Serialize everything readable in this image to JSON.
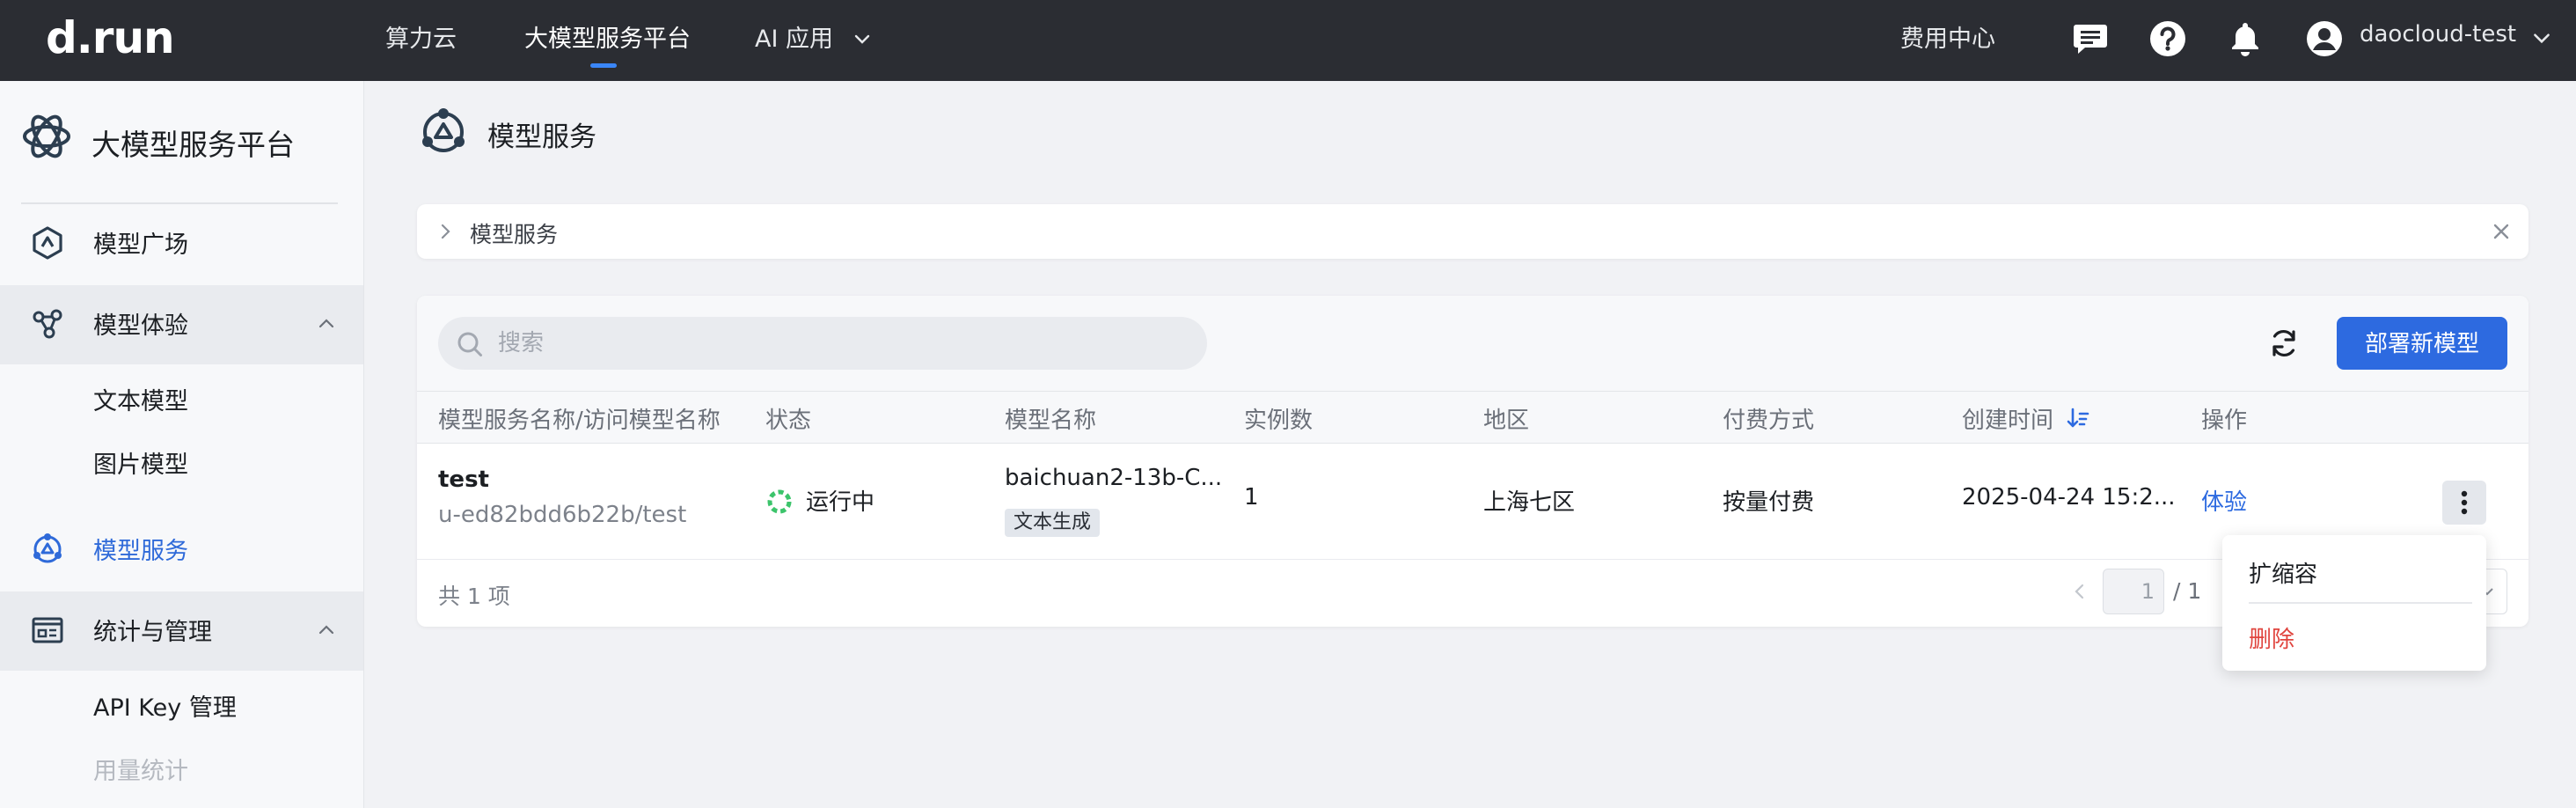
{
  "topbar": {
    "logo": "d.run",
    "nav": [
      {
        "label": "算力云"
      },
      {
        "label": "大模型服务平台"
      },
      {
        "label": "AI 应用"
      }
    ],
    "billing": "费用中心",
    "user": "daocloud-test"
  },
  "sidebar": {
    "title": "大模型服务平台",
    "items": [
      {
        "label": "模型广场"
      },
      {
        "label": "模型体验"
      },
      {
        "label": "文本模型"
      },
      {
        "label": "图片模型"
      },
      {
        "label": "模型服务"
      },
      {
        "label": "统计与管理"
      },
      {
        "label": "API Key 管理"
      },
      {
        "label": "用量统计"
      }
    ]
  },
  "page": {
    "title": "模型服务",
    "breadcrumb": "模型服务"
  },
  "toolbar": {
    "search_placeholder": "搜索",
    "deploy_label": "部署新模型"
  },
  "table": {
    "columns": [
      "模型服务名称/访问模型名称",
      "状态",
      "模型名称",
      "实例数",
      "地区",
      "付费方式",
      "创建时间",
      "操作"
    ],
    "rows": [
      {
        "name": "test",
        "access_name": "u-ed82bdd6b22b/test",
        "status": "运行中",
        "model": "baichuan2-13b-C...",
        "tag": "文本生成",
        "instances": "1",
        "region": "上海七区",
        "billing": "按量付费",
        "created": "2025-04-24 15:2...",
        "action": "体验"
      }
    ],
    "total": "共 1 项",
    "page_current": "1",
    "page_total": "/ 1"
  },
  "dropdown": {
    "items": [
      {
        "label": "扩缩容"
      },
      {
        "label": "删除"
      }
    ]
  },
  "colors": {
    "topbar": "#2b2d33",
    "accent": "#2d6ae0",
    "danger": "#e0443e",
    "status_running": "#3cc46b"
  }
}
